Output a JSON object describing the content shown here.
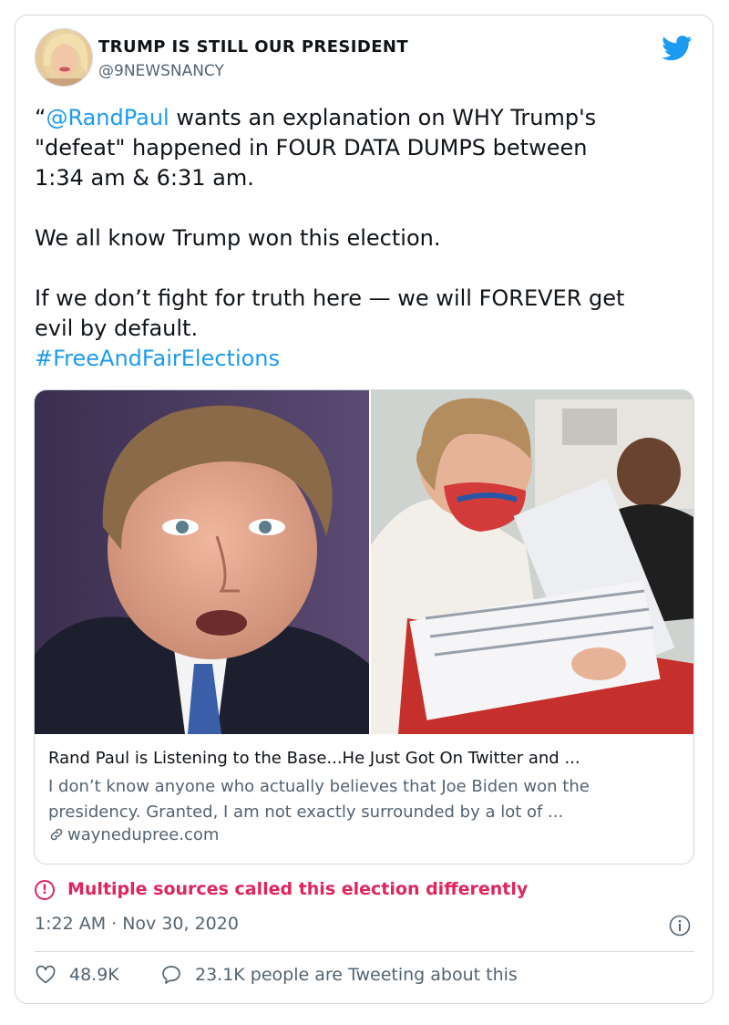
{
  "author": {
    "display_name": "TRUMP IS STILL OUR PRESIDENT",
    "handle": "@9NEWSNANCY",
    "avatar_icon": "avatar"
  },
  "brand": {
    "icon": "twitter-bird-icon",
    "color": "#1d9bf0"
  },
  "tweet": {
    "line1_quote": "“",
    "line1_mention": "@RandPaul",
    "line1_rest": " wants an explanation on WHY Trump's",
    "line2": "\"defeat\" happened in FOUR DATA DUMPS between",
    "line3": "1:34 am & 6:31 am.",
    "line4": "We all know Trump won this election.",
    "line5": "If we don’t fight for truth here — we will FOREVER get",
    "line6": "evil by default.",
    "hashtag": "#FreeAndFairElections"
  },
  "link_card": {
    "title": "Rand Paul is Listening to the Base...He Just Got On Twitter and ...",
    "description": "I don’t know anyone who actually believes that Joe Biden won the presidency. Granted, I am not exactly surrounded by a lot of ...",
    "domain": "waynedupree.com",
    "domain_icon": "link-icon"
  },
  "notice": {
    "icon": "exclamation-circle-icon",
    "text": "Multiple sources called this election differently",
    "color": "#e0245e"
  },
  "meta": {
    "timestamp": "1:22 AM · Nov 30, 2020",
    "info_icon": "info-icon"
  },
  "actions": {
    "likes": "48.9K",
    "like_icon": "heart-icon",
    "conversation": "23.1K people are Tweeting about this",
    "conversation_icon": "speech-bubble-icon"
  }
}
